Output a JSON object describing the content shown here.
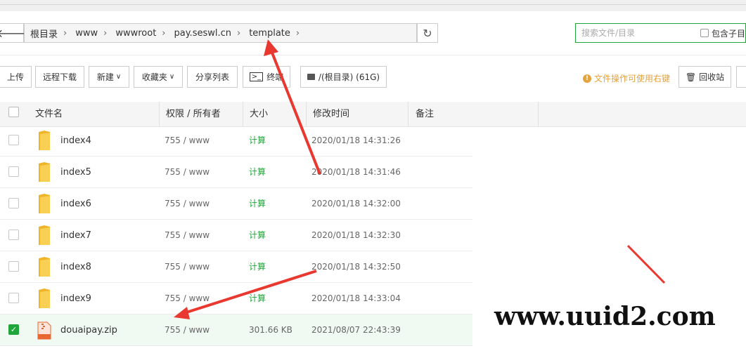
{
  "path": {
    "crumbs": [
      "根目录",
      "www",
      "wwwroot",
      "pay.seswl.cn",
      "template"
    ],
    "separator": "›"
  },
  "search": {
    "placeholder": "搜索文件/目录",
    "include_sub_label": "包含子目"
  },
  "toolbar": {
    "upload": "上传",
    "remote_download": "远程下载",
    "new": "新建",
    "favorites": "收藏夹",
    "share_list": "分享列表",
    "terminal": "终端",
    "disk": "/(根目录) (61G)",
    "tip": "文件操作可使用右键",
    "recycle": "回收站"
  },
  "table": {
    "headers": {
      "name": "文件名",
      "perm": "权限 / 所有者",
      "size": "大小",
      "mtime": "修改时间",
      "note": "备注"
    },
    "rows": [
      {
        "name": "index4",
        "perm": "755 / www",
        "size": "计算",
        "mtime": "2020/01/18 14:31:26"
      },
      {
        "name": "index5",
        "perm": "755 / www",
        "size": "计算",
        "mtime": "2020/01/18 14:31:46"
      },
      {
        "name": "index6",
        "perm": "755 / www",
        "size": "计算",
        "mtime": "2020/01/18 14:32:00"
      },
      {
        "name": "index7",
        "perm": "755 / www",
        "size": "计算",
        "mtime": "2020/01/18 14:32:30"
      },
      {
        "name": "index8",
        "perm": "755 / www",
        "size": "计算",
        "mtime": "2020/01/18 14:32:50"
      },
      {
        "name": "index9",
        "perm": "755 / www",
        "size": "计算",
        "mtime": "2020/01/18 14:33:04"
      },
      {
        "name": "douaipay.zip",
        "perm": "755 / www",
        "size": "301.66 KB",
        "mtime": "2021/08/07 22:43:39"
      }
    ]
  },
  "watermark": "www.uuid2.com",
  "colors": {
    "accent": "#20a53a",
    "arrow": "#e8382f",
    "folder": "#f5c542",
    "tip": "#e6a23c"
  }
}
